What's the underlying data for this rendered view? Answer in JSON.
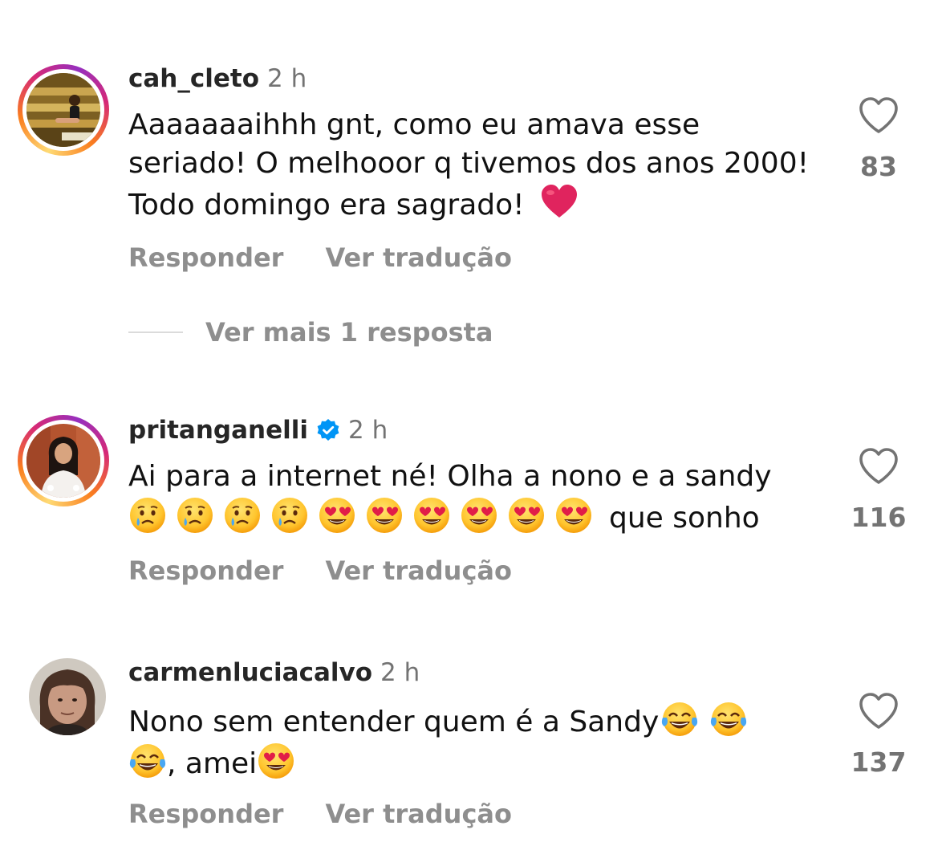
{
  "colors": {
    "text": "#111111",
    "username": "#262626",
    "meta": "#737373",
    "action": "#8e8e8e",
    "verified": "#0095f6",
    "heart_emoji": "#e0245e"
  },
  "actions": {
    "reply_label": "Responder",
    "translate_label": "Ver tradução"
  },
  "comments": [
    {
      "username": "cah_cleto",
      "time": "2 h",
      "verified": false,
      "avatar_icon": "story-ring-avatar",
      "text_part1": "Aaaaaaaihhh gnt, como eu amava esse seriado! O melhooor q tivemos dos anos 2000! Todo domingo era sagrado!",
      "emoji_icon": "red-heart-emoji",
      "likes": "83"
    },
    {
      "username": "pritanganelli",
      "time": "2 h",
      "verified": true,
      "avatar_icon": "story-ring-avatar",
      "text_part1": "Ai para a internet né! Olha a nono e a sandy",
      "emojis": [
        "crying-face-emoji",
        "crying-face-emoji",
        "crying-face-emoji",
        "crying-face-emoji",
        "heart-eyes-emoji",
        "heart-eyes-emoji",
        "heart-eyes-emoji",
        "heart-eyes-emoji",
        "heart-eyes-emoji",
        "heart-eyes-emoji"
      ],
      "text_part2": "que sonho",
      "likes": "116"
    },
    {
      "username": "carmenluciacalvo",
      "time": "2 h",
      "verified": false,
      "avatar_icon": "plain-avatar",
      "text_part1": "Nono sem entender quem é a Sandy",
      "text_part2": ", amei",
      "emojis": [
        "tears-of-joy-emoji",
        "tears-of-joy-emoji",
        "tears-of-joy-emoji",
        "heart-eyes-emoji"
      ],
      "likes": "137"
    }
  ],
  "more_replies": "Ver mais 1 resposta"
}
